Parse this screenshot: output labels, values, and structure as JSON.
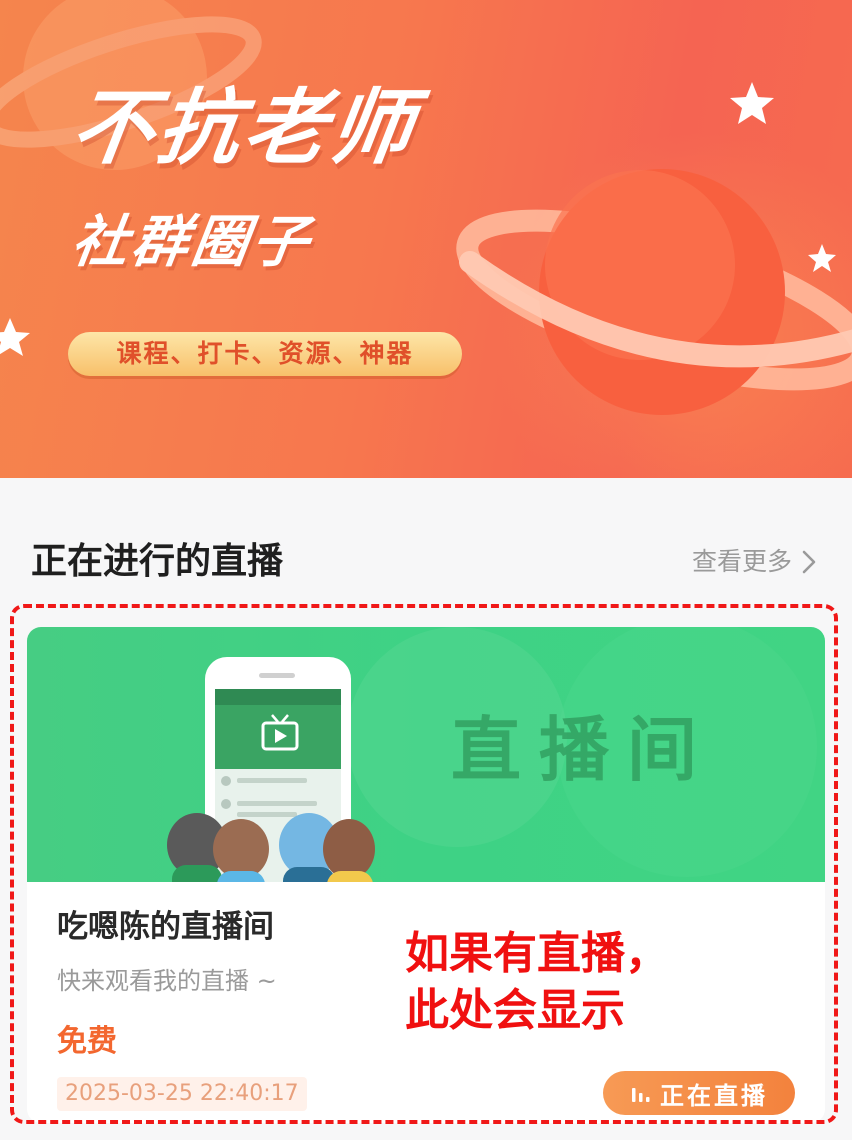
{
  "banner": {
    "title": "不抗老师",
    "subtitle": "社群圈子",
    "tags": "课程、打卡、资源、神器"
  },
  "section": {
    "title": "正在进行的直播",
    "more_label": "查看更多"
  },
  "live": {
    "cover_text": "直播间",
    "name": "吃嗯陈的直播间",
    "description": "快来观看我的直播 ~",
    "price": "免费",
    "time": "2025-03-25 22:40:17",
    "button_label": "正在直播"
  },
  "annotation": {
    "line1": "如果有直播，",
    "line2": "此处会显示"
  },
  "colors": {
    "banner_orange": "#f7774e",
    "cover_green": "#41d484",
    "price_orange": "#f3672f",
    "annotation_red": "#f01010"
  }
}
